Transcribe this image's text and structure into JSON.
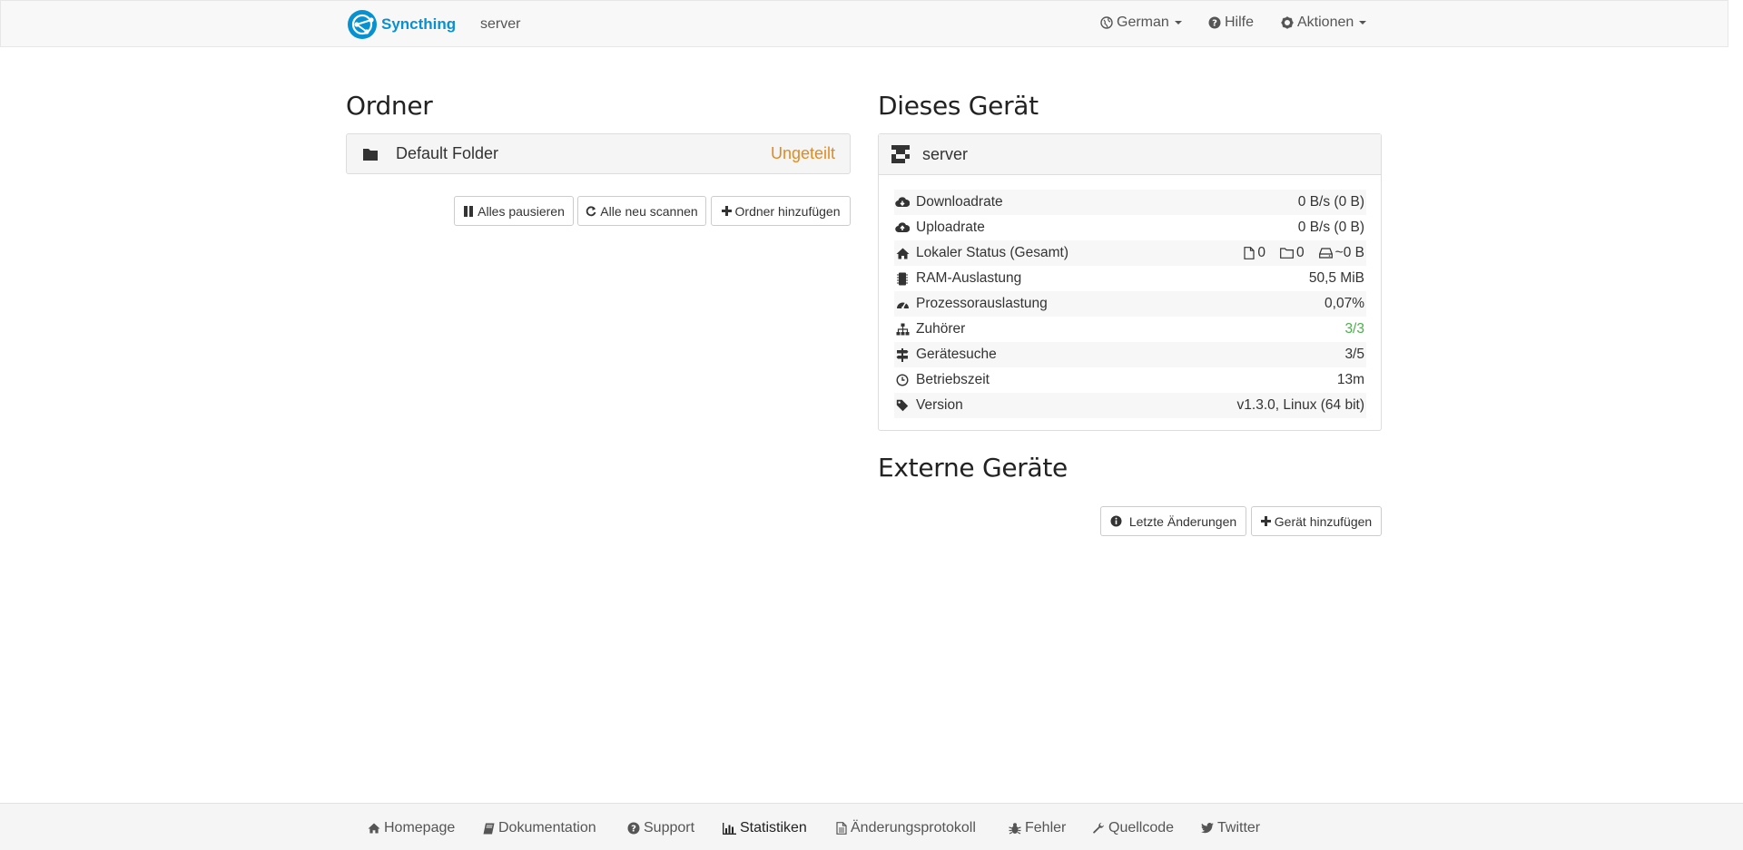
{
  "navbar": {
    "brand": "Syncthing",
    "host": "server",
    "language": "German",
    "help": "Hilfe",
    "actions": "Aktionen"
  },
  "folders": {
    "title": "Ordner",
    "items": [
      {
        "name": "Default Folder",
        "status": "Ungeteilt"
      }
    ],
    "buttons": {
      "pause_all": "Alles pausieren",
      "rescan_all": "Alle neu scannen",
      "add_folder": "Ordner hinzufügen"
    }
  },
  "this_device": {
    "title": "Dieses Gerät",
    "name": "server",
    "rows": {
      "download_label": "Downloadrate",
      "download_value": "0 B/s (0 B)",
      "upload_label": "Uploadrate",
      "upload_value": "0 B/s (0 B)",
      "local_label": "Lokaler Status (Gesamt)",
      "local_files": "0",
      "local_dirs": "0",
      "local_size": "~0 B",
      "ram_label": "RAM-Auslastung",
      "ram_value": "50,5 MiB",
      "cpu_label": "Prozessorauslastung",
      "cpu_value": "0,07%",
      "listeners_label": "Zuhörer",
      "listeners_value": "3/3",
      "discovery_label": "Gerätesuche",
      "discovery_value": "3/5",
      "uptime_label": "Betriebszeit",
      "uptime_value": "13m",
      "version_label": "Version",
      "version_value": "v1.3.0, Linux (64 bit)"
    }
  },
  "remote_devices": {
    "title": "Externe Geräte",
    "buttons": {
      "recent_changes": "Letzte Änderungen",
      "add_device": "Gerät hinzufügen"
    }
  },
  "footer": {
    "homepage": "Homepage",
    "docs": "Dokumentation",
    "support": "Support",
    "statistics": "Statistiken",
    "changelog": "Änderungsprotokoll",
    "bugs": "Fehler",
    "source": "Quellcode",
    "twitter": "Twitter"
  },
  "colors": {
    "brand": "#0891d1",
    "unshared": "#e28a1f",
    "ok_green": "#4cae4c"
  }
}
